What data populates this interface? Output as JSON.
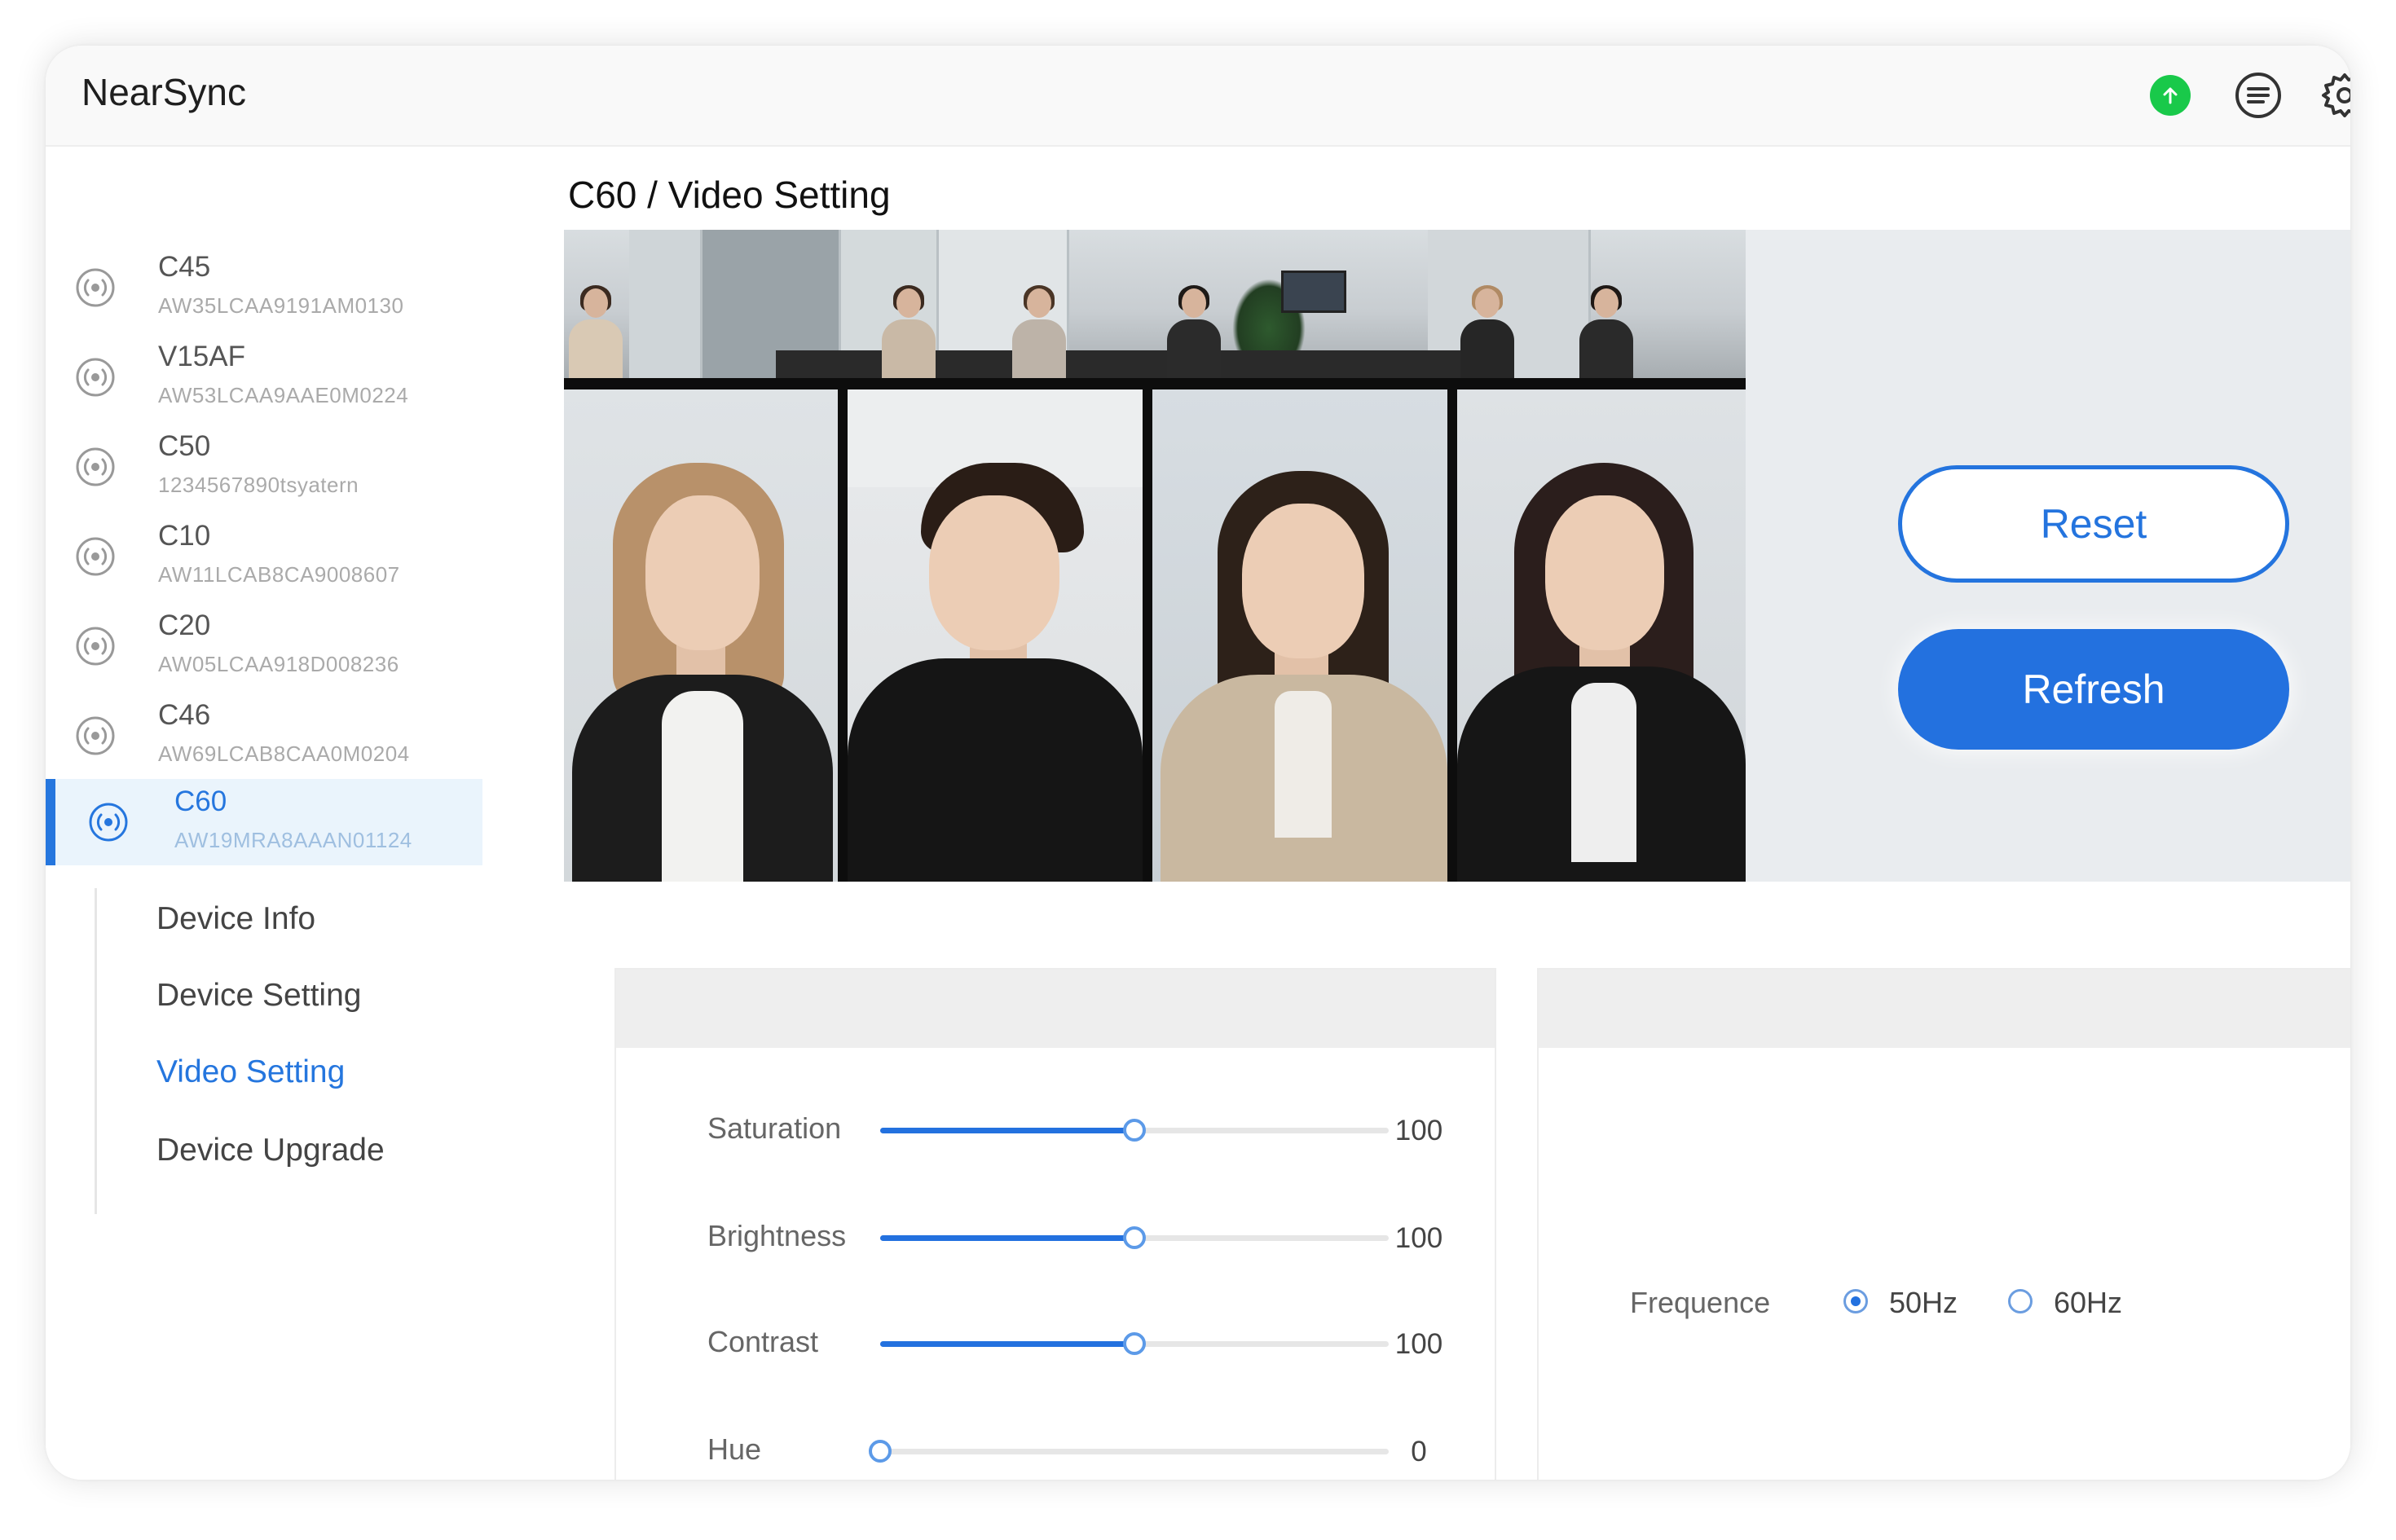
{
  "app": {
    "title": "NearSync"
  },
  "header": {
    "icons": [
      "upload-icon",
      "list-icon",
      "gear-icon"
    ],
    "status_color": "#19c94a"
  },
  "devices": [
    {
      "name": "C45",
      "serial": "AW35LCAA9191AM0130",
      "active": false
    },
    {
      "name": "V15AF",
      "serial": "AW53LCAA9AAE0M0224",
      "active": false
    },
    {
      "name": "C50",
      "serial": "1234567890tsyatern",
      "active": false
    },
    {
      "name": "C10",
      "serial": "AW11LCAB8CA9008607",
      "active": false
    },
    {
      "name": "C20",
      "serial": "AW05LCAA918D008236",
      "active": false
    },
    {
      "name": "C46",
      "serial": "AW69LCAB8CAA0M0204",
      "active": false
    },
    {
      "name": "C60",
      "serial": "AW19MRA8AAAN01124",
      "active": true
    }
  ],
  "submenu": {
    "items": [
      "Device Info",
      "Device Setting",
      "Video Setting",
      "Device Upgrade"
    ],
    "active": "Video Setting"
  },
  "page": {
    "title": "C60 / Video Setting"
  },
  "actions": {
    "reset_label": "Reset",
    "refresh_label": "Refresh"
  },
  "sliders": [
    {
      "label": "Saturation",
      "value": "100",
      "fraction": 0.5
    },
    {
      "label": "Brightness",
      "value": "100",
      "fraction": 0.5
    },
    {
      "label": "Contrast",
      "value": "100",
      "fraction": 0.5
    },
    {
      "label": "Hue",
      "value": "0",
      "fraction": 0.0
    }
  ],
  "frequence": {
    "label": "Frequence",
    "options": [
      {
        "label": "50Hz",
        "checked": true
      },
      {
        "label": "60Hz",
        "checked": false
      }
    ]
  },
  "colors": {
    "accent": "#2371df",
    "active_bg": "#eaf4fc"
  }
}
